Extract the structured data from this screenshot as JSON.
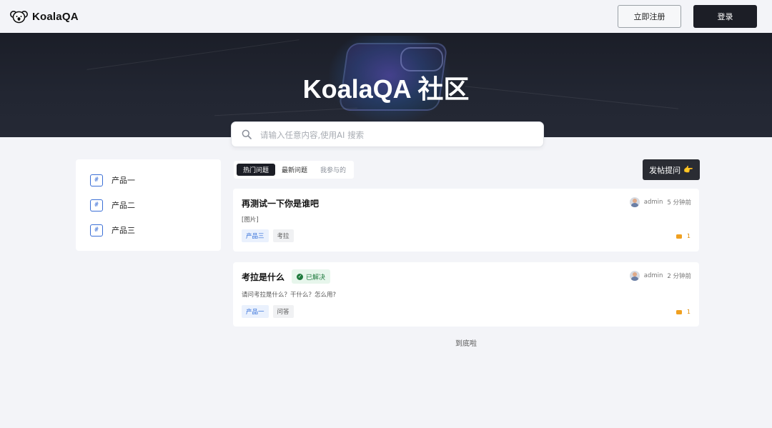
{
  "header": {
    "logo_text": "KoalaQA",
    "register_label": "立即注册",
    "login_label": "登录"
  },
  "banner": {
    "title": "KoalaQA 社区"
  },
  "search": {
    "placeholder": "请输入任意内容,使用AI 搜索",
    "value": ""
  },
  "sidebar": {
    "items": [
      {
        "icon": "#",
        "label": "产品一"
      },
      {
        "icon": "#",
        "label": "产品二"
      },
      {
        "icon": "#",
        "label": "产品三"
      }
    ]
  },
  "tabs": [
    {
      "label": "热门问题",
      "active": true
    },
    {
      "label": "最新问题",
      "active": false
    },
    {
      "label": "我参与的",
      "active": false
    }
  ],
  "ask_button": {
    "label": "发帖提问",
    "emoji": "👉"
  },
  "posts": [
    {
      "title": "再测试一下你是谁吧",
      "author": "admin",
      "time": "5 分钟前",
      "body": "[图片]",
      "tags": [
        "产品三",
        "考拉"
      ],
      "comments": "1"
    },
    {
      "title": "考拉是什么",
      "status": "已解决",
      "author": "admin",
      "time": "2 分钟前",
      "body": "请问考拉是什么？干什么？怎么用?",
      "tags": [
        "产品一",
        "问答"
      ],
      "comments": "1"
    }
  ],
  "footer": {
    "end_text": "到底啦"
  },
  "colors": {
    "accent_dark": "#1c1e26",
    "tag_blue": "#2f6cd8",
    "solved_green": "#1f7a3d",
    "comment_orange": "#f0a020"
  }
}
